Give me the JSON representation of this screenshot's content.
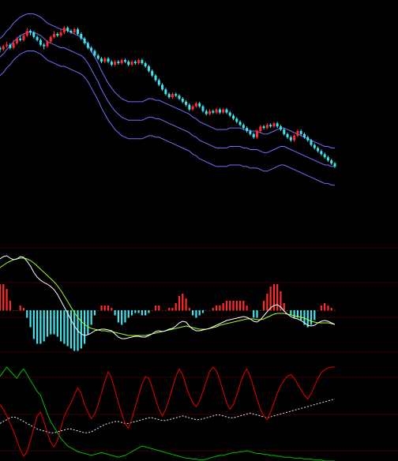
{
  "colors": {
    "background": "#000000",
    "band": "#6f6fff",
    "candle_up": "#ff2b2b",
    "candle_down": "#3fe6ee",
    "grid": "#3a0000",
    "dif": "#ffffff",
    "dea": "#9cff2b",
    "hist_up": "#ff2b2b",
    "hist_down": "#3fe6ee",
    "kdj_red": "#e80000",
    "kdj_green": "#00c000",
    "kdj_white": "#e8e8e8"
  },
  "chart_data": {
    "type": "stock",
    "x_count": 100,
    "price_panel": {
      "mid_band": [
        73,
        75,
        78,
        80,
        83,
        85,
        87,
        88,
        89,
        89,
        89,
        88,
        87,
        85,
        83,
        82,
        81,
        80,
        79,
        79,
        78,
        77,
        76,
        75,
        74,
        72,
        69,
        65,
        61,
        57,
        52,
        48,
        44,
        41,
        38,
        36,
        34,
        33,
        32,
        32,
        32,
        32,
        32,
        33,
        34,
        34,
        33,
        33,
        32,
        31,
        30,
        29,
        28,
        27,
        26,
        25,
        24,
        22,
        21,
        19,
        18,
        17,
        16,
        15,
        14,
        14,
        14,
        14,
        15,
        15,
        15,
        15,
        14,
        14,
        13,
        13,
        13,
        12,
        11,
        11,
        12,
        13,
        14,
        15,
        15,
        14,
        13,
        12,
        11,
        10,
        9,
        8,
        7,
        6,
        5,
        4,
        3,
        3,
        2,
        2
      ],
      "band_width": 12,
      "candles": [
        {
          "o": 79,
          "c": 78,
          "h": 80,
          "l": 76
        },
        {
          "o": 78,
          "c": 80,
          "h": 81,
          "l": 77
        },
        {
          "o": 80,
          "c": 81,
          "h": 83,
          "l": 79
        },
        {
          "o": 81,
          "c": 79,
          "h": 82,
          "l": 78
        },
        {
          "o": 79,
          "c": 82,
          "h": 84,
          "l": 78
        },
        {
          "o": 82,
          "c": 85,
          "h": 86,
          "l": 81
        },
        {
          "o": 85,
          "c": 84,
          "h": 87,
          "l": 83
        },
        {
          "o": 84,
          "c": 87,
          "h": 88,
          "l": 83
        },
        {
          "o": 87,
          "c": 90,
          "h": 92,
          "l": 86
        },
        {
          "o": 90,
          "c": 89,
          "h": 91,
          "l": 87
        },
        {
          "o": 89,
          "c": 86,
          "h": 90,
          "l": 85
        },
        {
          "o": 86,
          "c": 84,
          "h": 87,
          "l": 83
        },
        {
          "o": 84,
          "c": 81,
          "h": 85,
          "l": 80
        },
        {
          "o": 81,
          "c": 80,
          "h": 82,
          "l": 78
        },
        {
          "o": 80,
          "c": 83,
          "h": 84,
          "l": 79
        },
        {
          "o": 83,
          "c": 86,
          "h": 87,
          "l": 82
        },
        {
          "o": 86,
          "c": 88,
          "h": 90,
          "l": 85
        },
        {
          "o": 88,
          "c": 87,
          "h": 89,
          "l": 86
        },
        {
          "o": 87,
          "c": 89,
          "h": 91,
          "l": 86
        },
        {
          "o": 89,
          "c": 92,
          "h": 93,
          "l": 88
        },
        {
          "o": 92,
          "c": 90,
          "h": 93,
          "l": 89
        },
        {
          "o": 90,
          "c": 89,
          "h": 91,
          "l": 88
        },
        {
          "o": 89,
          "c": 91,
          "h": 92,
          "l": 88
        },
        {
          "o": 91,
          "c": 88,
          "h": 92,
          "l": 87
        },
        {
          "o": 88,
          "c": 85,
          "h": 89,
          "l": 84
        },
        {
          "o": 85,
          "c": 82,
          "h": 86,
          "l": 81
        },
        {
          "o": 82,
          "c": 79,
          "h": 83,
          "l": 78
        },
        {
          "o": 79,
          "c": 77,
          "h": 80,
          "l": 76
        },
        {
          "o": 77,
          "c": 74,
          "h": 78,
          "l": 73
        },
        {
          "o": 74,
          "c": 72,
          "h": 75,
          "l": 71
        },
        {
          "o": 72,
          "c": 70,
          "h": 73,
          "l": 69
        },
        {
          "o": 70,
          "c": 72,
          "h": 73,
          "l": 69
        },
        {
          "o": 72,
          "c": 70,
          "h": 73,
          "l": 69
        },
        {
          "o": 70,
          "c": 68,
          "h": 71,
          "l": 67
        },
        {
          "o": 68,
          "c": 70,
          "h": 71,
          "l": 67
        },
        {
          "o": 70,
          "c": 69,
          "h": 71,
          "l": 68
        },
        {
          "o": 69,
          "c": 71,
          "h": 72,
          "l": 68
        },
        {
          "o": 71,
          "c": 70,
          "h": 72,
          "l": 69
        },
        {
          "o": 70,
          "c": 68,
          "h": 71,
          "l": 67
        },
        {
          "o": 68,
          "c": 70,
          "h": 71,
          "l": 67
        },
        {
          "o": 70,
          "c": 69,
          "h": 71,
          "l": 68
        },
        {
          "o": 69,
          "c": 71,
          "h": 72,
          "l": 68
        },
        {
          "o": 71,
          "c": 69,
          "h": 72,
          "l": 68
        },
        {
          "o": 69,
          "c": 67,
          "h": 70,
          "l": 66
        },
        {
          "o": 67,
          "c": 64,
          "h": 68,
          "l": 63
        },
        {
          "o": 64,
          "c": 61,
          "h": 65,
          "l": 60
        },
        {
          "o": 61,
          "c": 58,
          "h": 62,
          "l": 57
        },
        {
          "o": 58,
          "c": 55,
          "h": 59,
          "l": 54
        },
        {
          "o": 55,
          "c": 52,
          "h": 56,
          "l": 51
        },
        {
          "o": 52,
          "c": 49,
          "h": 53,
          "l": 48
        },
        {
          "o": 49,
          "c": 47,
          "h": 50,
          "l": 46
        },
        {
          "o": 47,
          "c": 49,
          "h": 50,
          "l": 46
        },
        {
          "o": 49,
          "c": 48,
          "h": 50,
          "l": 47
        },
        {
          "o": 48,
          "c": 46,
          "h": 49,
          "l": 45
        },
        {
          "o": 46,
          "c": 44,
          "h": 47,
          "l": 43
        },
        {
          "o": 44,
          "c": 42,
          "h": 45,
          "l": 41
        },
        {
          "o": 42,
          "c": 39,
          "h": 43,
          "l": 38
        },
        {
          "o": 39,
          "c": 41,
          "h": 42,
          "l": 38
        },
        {
          "o": 41,
          "c": 43,
          "h": 44,
          "l": 40
        },
        {
          "o": 43,
          "c": 41,
          "h": 44,
          "l": 40
        },
        {
          "o": 41,
          "c": 38,
          "h": 42,
          "l": 37
        },
        {
          "o": 38,
          "c": 36,
          "h": 39,
          "l": 35
        },
        {
          "o": 36,
          "c": 38,
          "h": 39,
          "l": 35
        },
        {
          "o": 38,
          "c": 37,
          "h": 39,
          "l": 36
        },
        {
          "o": 37,
          "c": 39,
          "h": 40,
          "l": 36
        },
        {
          "o": 39,
          "c": 37,
          "h": 40,
          "l": 36
        },
        {
          "o": 37,
          "c": 39,
          "h": 40,
          "l": 36
        },
        {
          "o": 39,
          "c": 37,
          "h": 40,
          "l": 36
        },
        {
          "o": 37,
          "c": 35,
          "h": 38,
          "l": 34
        },
        {
          "o": 35,
          "c": 33,
          "h": 36,
          "l": 32
        },
        {
          "o": 33,
          "c": 31,
          "h": 34,
          "l": 30
        },
        {
          "o": 31,
          "c": 29,
          "h": 32,
          "l": 28
        },
        {
          "o": 29,
          "c": 27,
          "h": 30,
          "l": 26
        },
        {
          "o": 27,
          "c": 25,
          "h": 28,
          "l": 24
        },
        {
          "o": 25,
          "c": 23,
          "h": 26,
          "l": 22
        },
        {
          "o": 23,
          "c": 21,
          "h": 24,
          "l": 20
        },
        {
          "o": 21,
          "c": 25,
          "h": 26,
          "l": 20
        },
        {
          "o": 25,
          "c": 28,
          "h": 29,
          "l": 24
        },
        {
          "o": 28,
          "c": 27,
          "h": 29,
          "l": 26
        },
        {
          "o": 27,
          "c": 29,
          "h": 30,
          "l": 26
        },
        {
          "o": 29,
          "c": 28,
          "h": 30,
          "l": 27
        },
        {
          "o": 28,
          "c": 30,
          "h": 31,
          "l": 27
        },
        {
          "o": 30,
          "c": 28,
          "h": 31,
          "l": 27
        },
        {
          "o": 28,
          "c": 26,
          "h": 29,
          "l": 25
        },
        {
          "o": 26,
          "c": 23,
          "h": 27,
          "l": 22
        },
        {
          "o": 23,
          "c": 21,
          "h": 24,
          "l": 20
        },
        {
          "o": 21,
          "c": 19,
          "h": 22,
          "l": 18
        },
        {
          "o": 19,
          "c": 22,
          "h": 23,
          "l": 18
        },
        {
          "o": 22,
          "c": 25,
          "h": 26,
          "l": 21
        },
        {
          "o": 25,
          "c": 23,
          "h": 26,
          "l": 22
        },
        {
          "o": 23,
          "c": 21,
          "h": 24,
          "l": 20
        },
        {
          "o": 21,
          "c": 19,
          "h": 22,
          "l": 18
        },
        {
          "o": 19,
          "c": 16,
          "h": 20,
          "l": 15
        },
        {
          "o": 16,
          "c": 14,
          "h": 17,
          "l": 13
        },
        {
          "o": 14,
          "c": 12,
          "h": 15,
          "l": 11
        },
        {
          "o": 12,
          "c": 10,
          "h": 13,
          "l": 9
        },
        {
          "o": 10,
          "c": 8,
          "h": 11,
          "l": 7
        },
        {
          "o": 8,
          "c": 6,
          "h": 9,
          "l": 5
        },
        {
          "o": 6,
          "c": 4,
          "h": 7,
          "l": 3
        },
        {
          "o": 4,
          "c": 2,
          "h": 5,
          "l": 1
        }
      ]
    },
    "macd_panel": {
      "dif": [
        6.5,
        6.8,
        6.9,
        6.6,
        6.4,
        6.5,
        6.8,
        6.7,
        6.2,
        5.6,
        4.8,
        4.2,
        3.8,
        3.5,
        3.3,
        3.0,
        2.6,
        2.0,
        1.2,
        0.4,
        -0.4,
        -1.2,
        -2.0,
        -2.6,
        -3.0,
        -3.2,
        -3.1,
        -2.9,
        -2.6,
        -2.5,
        -2.4,
        -2.4,
        -2.5,
        -2.6,
        -3.0,
        -3.4,
        -3.6,
        -3.6,
        -3.5,
        -3.4,
        -3.3,
        -3.3,
        -3.4,
        -3.4,
        -3.2,
        -3.0,
        -2.7,
        -2.6,
        -2.7,
        -2.6,
        -2.4,
        -2.3,
        -2.0,
        -1.6,
        -1.4,
        -1.5,
        -2.0,
        -2.4,
        -2.6,
        -2.6,
        -2.5,
        -2.4,
        -2.3,
        -2.1,
        -1.9,
        -1.7,
        -1.5,
        -1.3,
        -1.2,
        -1.1,
        -1.0,
        -0.9,
        -0.8,
        -0.9,
        -1.1,
        -1.4,
        -1.5,
        -1.2,
        -0.7,
        -0.2,
        0.3,
        0.6,
        0.7,
        0.4,
        -0.1,
        -0.5,
        -0.8,
        -1.0,
        -1.1,
        -1.3,
        -1.6,
        -1.9,
        -2.0,
        -1.9,
        -1.6,
        -1.4,
        -1.3,
        -1.4,
        -1.6,
        -1.8
      ],
      "dea": [
        5.4,
        5.7,
        6.0,
        6.2,
        6.4,
        6.5,
        6.6,
        6.6,
        6.5,
        6.3,
        6.0,
        5.6,
        5.2,
        4.8,
        4.4,
        4.0,
        3.6,
        3.1,
        2.5,
        1.8,
        1.1,
        0.4,
        -0.3,
        -0.9,
        -1.4,
        -1.8,
        -2.1,
        -2.3,
        -2.4,
        -2.5,
        -2.6,
        -2.6,
        -2.7,
        -2.7,
        -2.8,
        -2.9,
        -3.0,
        -3.1,
        -3.2,
        -3.2,
        -3.2,
        -3.2,
        -3.2,
        -3.2,
        -3.1,
        -3.0,
        -2.9,
        -2.8,
        -2.7,
        -2.6,
        -2.5,
        -2.4,
        -2.3,
        -2.2,
        -2.1,
        -2.0,
        -2.1,
        -2.2,
        -2.3,
        -2.4,
        -2.4,
        -2.4,
        -2.3,
        -2.2,
        -2.1,
        -1.9,
        -1.8,
        -1.7,
        -1.6,
        -1.5,
        -1.4,
        -1.3,
        -1.2,
        -1.1,
        -1.1,
        -1.1,
        -1.2,
        -1.2,
        -1.1,
        -0.9,
        -0.7,
        -0.5,
        -0.4,
        -0.4,
        -0.4,
        -0.5,
        -0.6,
        -0.7,
        -0.8,
        -0.9,
        -1.0,
        -1.2,
        -1.4,
        -1.5,
        -1.6,
        -1.6,
        -1.6,
        -1.6,
        -1.7,
        -1.8
      ],
      "zero_level": 0
    },
    "kdj_panel": {
      "red": [
        60,
        55,
        48,
        40,
        32,
        22,
        12,
        5,
        10,
        22,
        35,
        48,
        52,
        42,
        30,
        20,
        15,
        22,
        35,
        48,
        55,
        62,
        70,
        78,
        72,
        60,
        52,
        45,
        50,
        60,
        72,
        85,
        95,
        88,
        75,
        62,
        50,
        40,
        35,
        45,
        58,
        70,
        82,
        90,
        88,
        78,
        66,
        55,
        48,
        55,
        66,
        78,
        90,
        98,
        92,
        80,
        70,
        62,
        58,
        64,
        74,
        85,
        95,
        100,
        96,
        86,
        74,
        62,
        55,
        60,
        70,
        82,
        92,
        98,
        90,
        78,
        66,
        55,
        48,
        44,
        52,
        62,
        72,
        80,
        86,
        90,
        92,
        88,
        82,
        76,
        70,
        66,
        72,
        80,
        88,
        94,
        97,
        99,
        100,
        100
      ],
      "green": [
        90,
        95,
        100,
        96,
        92,
        88,
        94,
        98,
        92,
        86,
        80,
        74,
        70,
        60,
        50,
        42,
        36,
        30,
        24,
        20,
        16,
        14,
        12,
        10,
        9,
        8,
        7,
        6,
        7,
        8,
        9,
        8,
        7,
        6,
        5,
        4,
        5,
        6,
        8,
        10,
        12,
        14,
        16,
        15,
        14,
        13,
        12,
        11,
        10,
        9,
        8,
        7,
        6,
        5,
        4,
        3,
        3,
        2,
        2,
        1,
        1,
        2,
        3,
        4,
        5,
        6,
        6,
        7,
        8,
        9,
        9,
        10,
        10,
        11,
        10,
        9,
        8,
        8,
        7,
        7,
        6,
        6,
        5,
        5,
        4,
        4,
        4,
        3,
        3,
        3,
        2,
        2,
        2,
        1,
        1,
        1,
        0,
        0,
        0,
        0
      ],
      "white": [
        40,
        42,
        44,
        46,
        47,
        46,
        44,
        42,
        40,
        38,
        36,
        34,
        33,
        32,
        31,
        30,
        30,
        31,
        32,
        33,
        34,
        34,
        33,
        32,
        31,
        30,
        30,
        31,
        33,
        35,
        37,
        39,
        40,
        41,
        42,
        42,
        41,
        40,
        40,
        41,
        42,
        43,
        44,
        45,
        46,
        46,
        45,
        44,
        43,
        43,
        44,
        45,
        46,
        47,
        48,
        47,
        46,
        45,
        44,
        44,
        45,
        46,
        47,
        48,
        49,
        49,
        48,
        47,
        46,
        46,
        47,
        48,
        49,
        50,
        51,
        50,
        49,
        48,
        47,
        46,
        47,
        48,
        49,
        50,
        51,
        52,
        53,
        54,
        55,
        56,
        57,
        58,
        59,
        60,
        61,
        62,
        63,
        64,
        65,
        66
      ]
    }
  }
}
